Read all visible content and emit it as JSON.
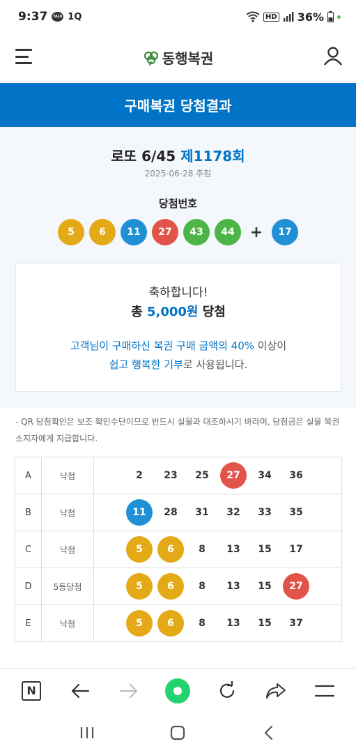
{
  "status": {
    "time": "9:37",
    "kakao_label": "TALK",
    "notif_text": "1Q",
    "hd_label": "HD",
    "battery": "36%"
  },
  "header": {
    "logo_text": "동행복권"
  },
  "page_title": "구매복권 당첨결과",
  "draw": {
    "game": "로또 6/45",
    "round": "제1178회",
    "date": "2025-06-28 추첨",
    "win_label": "당첨번호",
    "numbers": [
      "5",
      "6",
      "11",
      "27",
      "43",
      "44"
    ],
    "plus": "+",
    "bonus": "17"
  },
  "prize_card": {
    "congrats": "축하합니다!",
    "total_prefix": "총",
    "amount": "5,000원",
    "total_suffix": "당첨",
    "donate_hl1": "고객님이 구매하신 복권 구매 금액의 40%",
    "donate_rest1": " 이상이",
    "donate_hl2": "쉽고 행복한 기부",
    "donate_rest2": "로 사용됩니다."
  },
  "notice": "- QR 당첨확인은 보조 확인수단이므로 반드시 실물과 대조하시기 바라며, 당첨금은 실물 복권소지자에게 지급합니다.",
  "tickets": [
    {
      "label": "A",
      "result": "낙첨",
      "numbers": [
        "2",
        "23",
        "25",
        "27",
        "34",
        "36"
      ]
    },
    {
      "label": "B",
      "result": "낙첨",
      "numbers": [
        "11",
        "28",
        "31",
        "32",
        "33",
        "35"
      ]
    },
    {
      "label": "C",
      "result": "낙첨",
      "numbers": [
        "5",
        "6",
        "8",
        "13",
        "15",
        "17"
      ]
    },
    {
      "label": "D",
      "result": "5등당첨",
      "numbers": [
        "5",
        "6",
        "8",
        "13",
        "15",
        "27"
      ]
    },
    {
      "label": "E",
      "result": "낙첨",
      "numbers": [
        "5",
        "6",
        "8",
        "13",
        "15",
        "37"
      ]
    }
  ],
  "colors": {
    "brand_blue": "#0174c8",
    "ball_yellow": "#e4a916",
    "ball_blue": "#1f8fd6",
    "ball_red": "#e2544a",
    "ball_green": "#4bb545",
    "browser_home": "#22d36f"
  },
  "icons": {
    "menu": "hamburger-icon",
    "user": "user-icon",
    "back": "arrow-left-icon",
    "forward": "arrow-right-icon",
    "reload": "reload-icon",
    "share": "share-icon",
    "more": "menu-lines-icon"
  }
}
